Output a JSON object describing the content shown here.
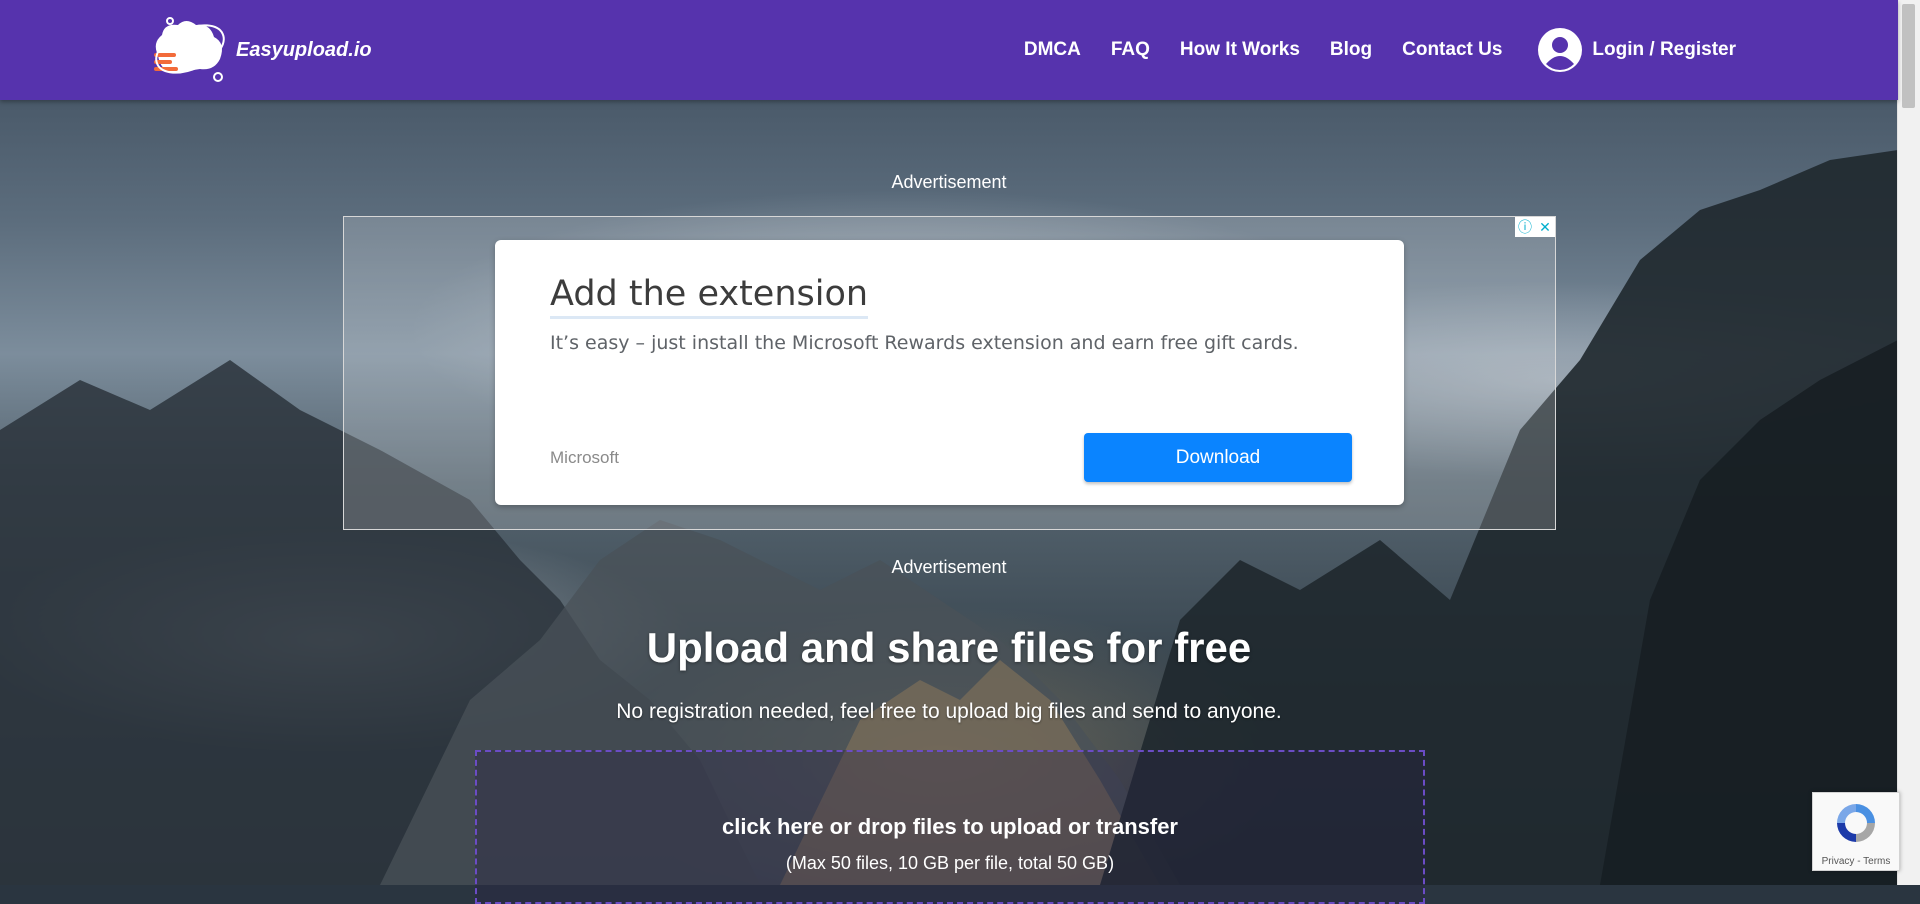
{
  "header": {
    "logo_text": "Easyupload.io",
    "nav": [
      {
        "label": "DMCA"
      },
      {
        "label": "FAQ"
      },
      {
        "label": "How It Works"
      },
      {
        "label": "Blog"
      },
      {
        "label": "Contact Us"
      }
    ],
    "login_label": "Login / Register",
    "icons": {
      "logo": "cloud-heart-logo",
      "account": "user-circle-icon"
    }
  },
  "ad": {
    "label_top": "Advertisement",
    "label_bottom": "Advertisement",
    "headline": "Add the extension",
    "description": "It’s easy – just install the Microsoft Rewards extension and earn free gift cards.",
    "brand": "Microsoft",
    "cta": "Download",
    "icons": {
      "info": "ad-info-icon",
      "close": "ad-close-icon"
    }
  },
  "hero": {
    "title": "Upload and share files for free",
    "subtitle": "No registration needed, feel free to upload big files and send to anyone."
  },
  "dropzone": {
    "main": "click here or drop files to upload or transfer",
    "limits": "(Max 50 files, 10 GB per file, total 50 GB)"
  },
  "recaptcha": {
    "links": "Privacy - Terms",
    "icon": "recaptcha-logo-icon"
  },
  "colors": {
    "header_bg": "#5633ad",
    "ad_cta_bg": "#0a84ff",
    "dropzone_border": "#6b4cc5"
  }
}
